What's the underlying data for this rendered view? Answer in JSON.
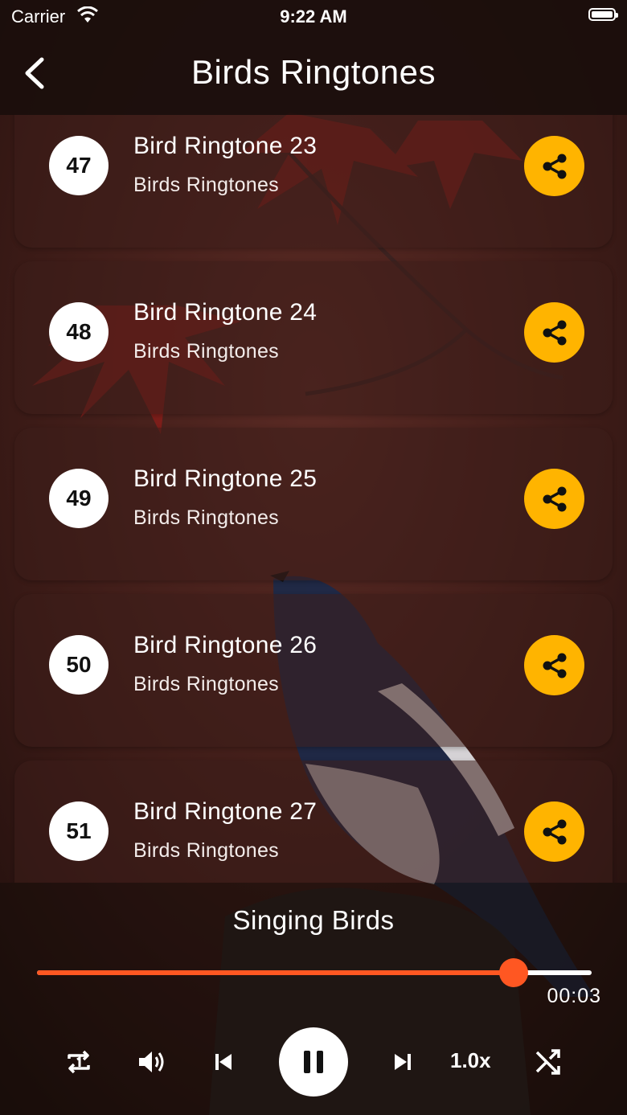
{
  "status_bar": {
    "carrier": "Carrier",
    "time": "9:22 AM"
  },
  "header": {
    "title": "Birds Ringtones",
    "back_icon": "chevron-left-icon"
  },
  "ringtones": [
    {
      "number": "47",
      "title": "Bird Ringtone 23",
      "subtitle": "Birds Ringtones"
    },
    {
      "number": "48",
      "title": "Bird Ringtone 24",
      "subtitle": "Birds Ringtones"
    },
    {
      "number": "49",
      "title": "Bird Ringtone 25",
      "subtitle": "Birds Ringtones"
    },
    {
      "number": "50",
      "title": "Bird Ringtone 26",
      "subtitle": "Birds Ringtones"
    },
    {
      "number": "51",
      "title": "Bird Ringtone 27",
      "subtitle": "Birds Ringtones"
    }
  ],
  "player": {
    "song_title": "Singing Birds",
    "elapsed": "00:03",
    "progress_fraction": 0.86,
    "speed_label": "1.0x",
    "controls": [
      "repeat-one-icon",
      "volume-icon",
      "skip-previous-icon",
      "pause-icon",
      "skip-next-icon",
      "speed",
      "shuffle-icon"
    ]
  },
  "colors": {
    "accent": "#ff5722",
    "share_button": "#ffb400",
    "card_background": "#3c1e1a"
  }
}
